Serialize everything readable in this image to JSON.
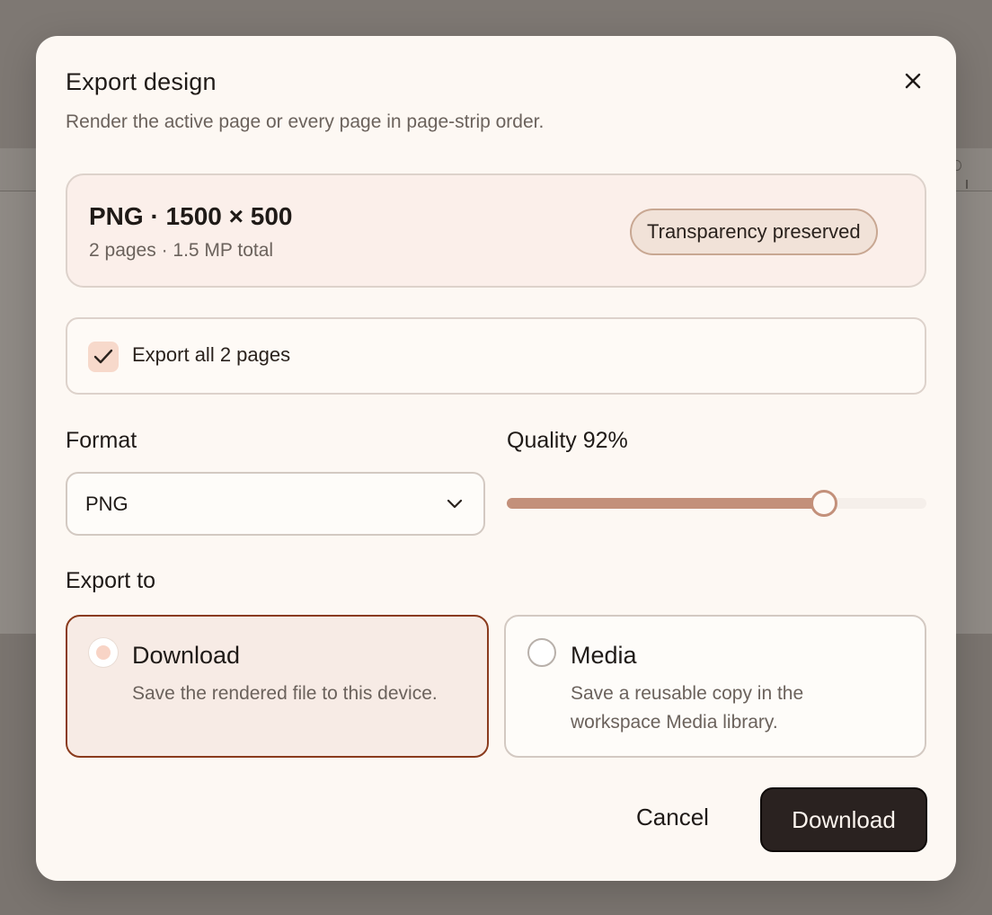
{
  "dialog": {
    "title": "Export design",
    "subtitle": "Render the active page or every page in page-strip order."
  },
  "summary": {
    "title": "PNG · 1500 × 500",
    "details": "2 pages · 1.5 MP total",
    "badge": "Transparency preserved"
  },
  "export_all": {
    "label": "Export all 2 pages",
    "checked": true
  },
  "format": {
    "label": "Format",
    "selected": "PNG"
  },
  "quality": {
    "label": "Quality 92%",
    "value": 0.92
  },
  "export_to": {
    "label": "Export to",
    "options": [
      {
        "title": "Download",
        "description": "Save the rendered file to this device.",
        "selected": true
      },
      {
        "title": "Media",
        "description": "Save a reusable copy in the workspace Media library.",
        "selected": false
      }
    ]
  },
  "footer": {
    "cancel_label": "Cancel",
    "primary_label": "Download"
  },
  "icons": {
    "close": "close-icon",
    "check": "checkmark-icon",
    "dropdown": "chevron-down-icon"
  },
  "colors": {
    "accent": "#8a3b1d",
    "slider": "#c3907a",
    "primary_button": "#2a2220"
  }
}
